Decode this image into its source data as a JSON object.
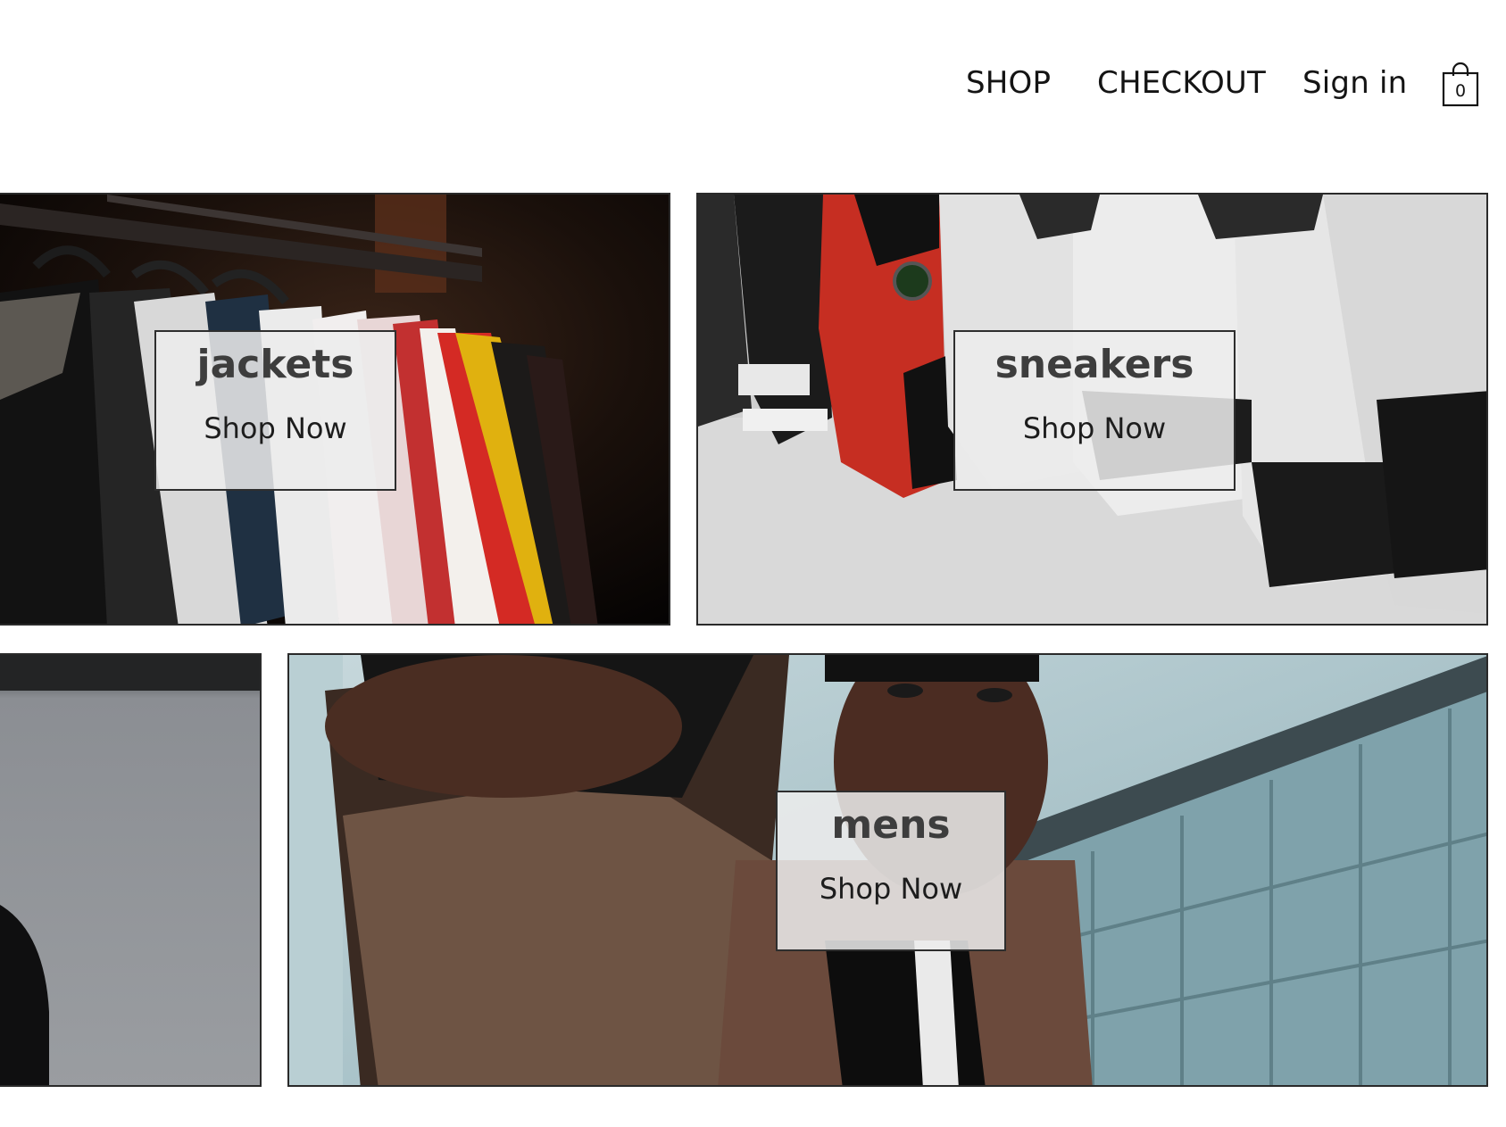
{
  "header": {
    "nav": {
      "shop": "SHOP",
      "checkout": "CHECKOUT",
      "sign_in": "Sign in"
    },
    "cart": {
      "icon": "shopping-bag-icon",
      "count": "0"
    }
  },
  "categories": [
    {
      "title": "jackets",
      "cta": "Shop Now"
    },
    {
      "title": "sneakers",
      "cta": "Shop Now"
    },
    {
      "title": "mens",
      "cta": "Shop Now"
    }
  ],
  "colors": {
    "text": "#141414",
    "overlay_bg": "#ececec",
    "border": "#2a2a2a"
  }
}
